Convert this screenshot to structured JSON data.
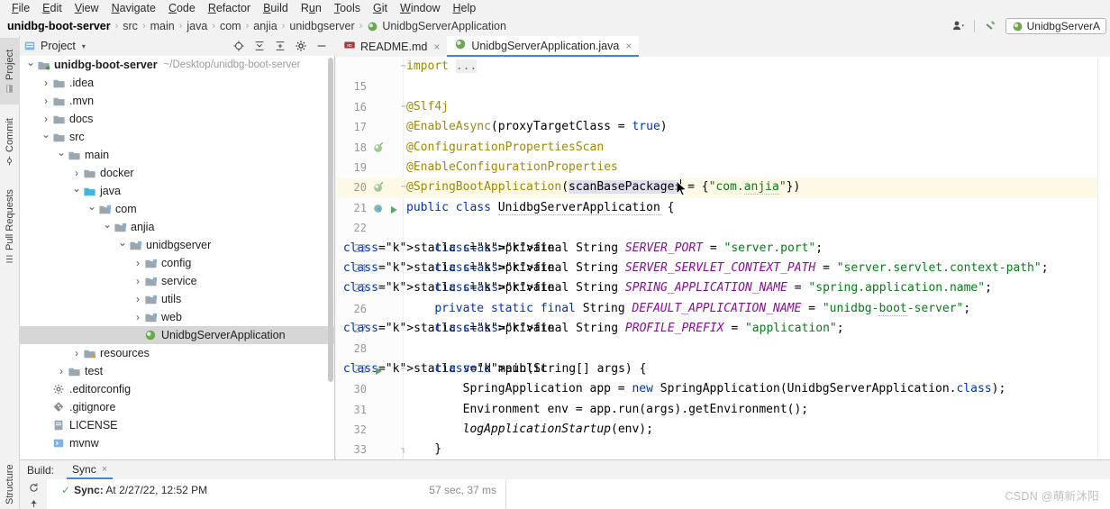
{
  "menubar": {
    "items": [
      {
        "label": "File",
        "mnemonic": "F"
      },
      {
        "label": "Edit",
        "mnemonic": "E"
      },
      {
        "label": "View",
        "mnemonic": "V"
      },
      {
        "label": "Navigate",
        "mnemonic": "N"
      },
      {
        "label": "Code",
        "mnemonic": "C"
      },
      {
        "label": "Refactor",
        "mnemonic": "R"
      },
      {
        "label": "Build",
        "mnemonic": "B"
      },
      {
        "label": "Run",
        "mnemonic": "u"
      },
      {
        "label": "Tools",
        "mnemonic": "T"
      },
      {
        "label": "Git",
        "mnemonic": "G"
      },
      {
        "label": "Window",
        "mnemonic": "W"
      },
      {
        "label": "Help",
        "mnemonic": "H"
      }
    ]
  },
  "navbar": {
    "breadcrumbs": [
      "unidbg-boot-server",
      "src",
      "main",
      "java",
      "com",
      "anjia",
      "unidbgserver",
      "UnidbgServerApplication"
    ],
    "separator": "›",
    "run_config": "UnidbgServerA",
    "icons": {
      "settings": "person-settings-icon",
      "build": "hammer-icon",
      "run_config_icon": "java-class-icon"
    }
  },
  "left_strip": {
    "tabs": [
      {
        "label": "Project",
        "active": true,
        "icon": "project-icon"
      },
      {
        "label": "Commit",
        "active": false,
        "icon": "commit-icon"
      },
      {
        "label": "Pull Requests",
        "active": false,
        "icon": "pull-request-icon"
      }
    ],
    "bottom_tab": {
      "label": "Structure",
      "icon": "structure-icon"
    }
  },
  "project_panel": {
    "title": "Project",
    "chevron": "▾",
    "header_icons": [
      "target-icon",
      "collapse-all-icon",
      "expand-all-icon",
      "gear-icon",
      "minimize-icon"
    ],
    "tree": [
      {
        "depth": 0,
        "arrow": "v",
        "icon": "module-icon",
        "label": "unidbg-boot-server",
        "bold": true,
        "path": "~/Desktop/unidbg-boot-server",
        "selected": false
      },
      {
        "depth": 1,
        "arrow": ">",
        "icon": "folder-icon",
        "label": ".idea",
        "bold": false,
        "path": "",
        "selected": false
      },
      {
        "depth": 1,
        "arrow": ">",
        "icon": "folder-icon",
        "label": ".mvn",
        "bold": false,
        "path": "",
        "selected": false
      },
      {
        "depth": 1,
        "arrow": ">",
        "icon": "folder-icon",
        "label": "docs",
        "bold": false,
        "path": "",
        "selected": false
      },
      {
        "depth": 1,
        "arrow": "v",
        "icon": "folder-icon",
        "label": "src",
        "bold": false,
        "path": "",
        "selected": false
      },
      {
        "depth": 2,
        "arrow": "v",
        "icon": "folder-icon",
        "label": "main",
        "bold": false,
        "path": "",
        "selected": false
      },
      {
        "depth": 3,
        "arrow": ">",
        "icon": "folder-icon",
        "label": "docker",
        "bold": false,
        "path": "",
        "selected": false
      },
      {
        "depth": 3,
        "arrow": "v",
        "icon": "source-icon",
        "label": "java",
        "bold": false,
        "path": "",
        "selected": false
      },
      {
        "depth": 4,
        "arrow": "v",
        "icon": "package-icon",
        "label": "com",
        "bold": false,
        "path": "",
        "selected": false
      },
      {
        "depth": 5,
        "arrow": "v",
        "icon": "package-icon",
        "label": "anjia",
        "bold": false,
        "path": "",
        "selected": false
      },
      {
        "depth": 6,
        "arrow": "v",
        "icon": "package-icon",
        "label": "unidbgserver",
        "bold": false,
        "path": "",
        "selected": false
      },
      {
        "depth": 7,
        "arrow": ">",
        "icon": "package-icon",
        "label": "config",
        "bold": false,
        "path": "",
        "selected": false
      },
      {
        "depth": 7,
        "arrow": ">",
        "icon": "package-icon",
        "label": "service",
        "bold": false,
        "path": "",
        "selected": false
      },
      {
        "depth": 7,
        "arrow": ">",
        "icon": "package-icon",
        "label": "utils",
        "bold": false,
        "path": "",
        "selected": false
      },
      {
        "depth": 7,
        "arrow": ">",
        "icon": "package-icon",
        "label": "web",
        "bold": false,
        "path": "",
        "selected": false
      },
      {
        "depth": 7,
        "arrow": "",
        "icon": "java-class-icon",
        "label": "UnidbgServerApplication",
        "bold": false,
        "path": "",
        "selected": true
      },
      {
        "depth": 3,
        "arrow": ">",
        "icon": "resource-icon",
        "label": "resources",
        "bold": false,
        "path": "",
        "selected": false
      },
      {
        "depth": 2,
        "arrow": ">",
        "icon": "folder-icon",
        "label": "test",
        "bold": false,
        "path": "",
        "selected": false
      },
      {
        "depth": 1,
        "arrow": "",
        "icon": "editorconfig-icon",
        "label": ".editorconfig",
        "bold": false,
        "path": "",
        "selected": false
      },
      {
        "depth": 1,
        "arrow": "",
        "icon": "gitignore-icon",
        "label": ".gitignore",
        "bold": false,
        "path": "",
        "selected": false
      },
      {
        "depth": 1,
        "arrow": "",
        "icon": "license-icon",
        "label": "LICENSE",
        "bold": false,
        "path": "",
        "selected": false
      },
      {
        "depth": 1,
        "arrow": "",
        "icon": "script-icon",
        "label": "mvnw",
        "bold": false,
        "path": "",
        "selected": false
      }
    ]
  },
  "editor": {
    "tabs": [
      {
        "label": "README.md",
        "icon": "markdown-icon",
        "active": false,
        "close": "×"
      },
      {
        "label": "UnidbgServerApplication.java",
        "icon": "java-class-icon",
        "active": true,
        "close": "×"
      }
    ],
    "code_lines": [
      {
        "num": "",
        "text": "import ...",
        "partial": true
      },
      {
        "num": "15",
        "text": ""
      },
      {
        "num": "16",
        "text": "@Slf4j"
      },
      {
        "num": "17",
        "text": "@EnableAsync(proxyTargetClass = true)"
      },
      {
        "num": "18",
        "text": "@ConfigurationPropertiesScan"
      },
      {
        "num": "19",
        "text": "@EnableConfigurationProperties"
      },
      {
        "num": "20",
        "text": "@SpringBootApplication(scanBasePackages = {\"com.anjia\"})"
      },
      {
        "num": "21",
        "text": "public class UnidbgServerApplication {"
      },
      {
        "num": "22",
        "text": ""
      },
      {
        "num": "23",
        "text": "    private static final String SERVER_PORT = \"server.port\";"
      },
      {
        "num": "24",
        "text": "    private static final String SERVER_SERVLET_CONTEXT_PATH = \"server.servlet.context-path\";"
      },
      {
        "num": "25",
        "text": "    private static final String SPRING_APPLICATION_NAME = \"spring.application.name\";"
      },
      {
        "num": "26",
        "text": "    private static final String DEFAULT_APPLICATION_NAME = \"unidbg-boot-server\";"
      },
      {
        "num": "27",
        "text": "    private static final String PROFILE_PREFIX = \"application\";"
      },
      {
        "num": "28",
        "text": ""
      },
      {
        "num": "29",
        "text": "    public static void main(String[] args) {"
      },
      {
        "num": "30",
        "text": "        SpringApplication app = new SpringApplication(UnidbgServerApplication.class);"
      },
      {
        "num": "31",
        "text": "        Environment env = app.run(args).getEnvironment();"
      },
      {
        "num": "32",
        "text": "        logApplicationStartup(env);"
      },
      {
        "num": "33",
        "text": "    }"
      }
    ],
    "gutter_icons": {
      "line18": "bean-icon",
      "line20": "bean-icon",
      "line21": "spring-boot-run-icon",
      "line21_run": "run-icon",
      "line29": "run-icon"
    }
  },
  "build_panel": {
    "label": "Build:",
    "tab": "Sync",
    "tab_close": "×",
    "status_icon": "checkmark-icon",
    "status_prefix": "Sync:",
    "status_text": "At 2/27/22, 12:52 PM",
    "duration": "57 sec, 37 ms",
    "side_icons": [
      "rerun-icon",
      "pin-icon"
    ]
  },
  "watermark": "CSDN @萌新沐阳",
  "colors": {
    "accent": "#3e86d6",
    "keyword": "#0033b3",
    "annotation": "#9e880d",
    "string": "#067d17",
    "constant": "#871094",
    "selection": "#d6d6d6",
    "highlight_line": "#fcfae6",
    "success": "#59a869",
    "panel_bg": "#f2f2f2"
  }
}
